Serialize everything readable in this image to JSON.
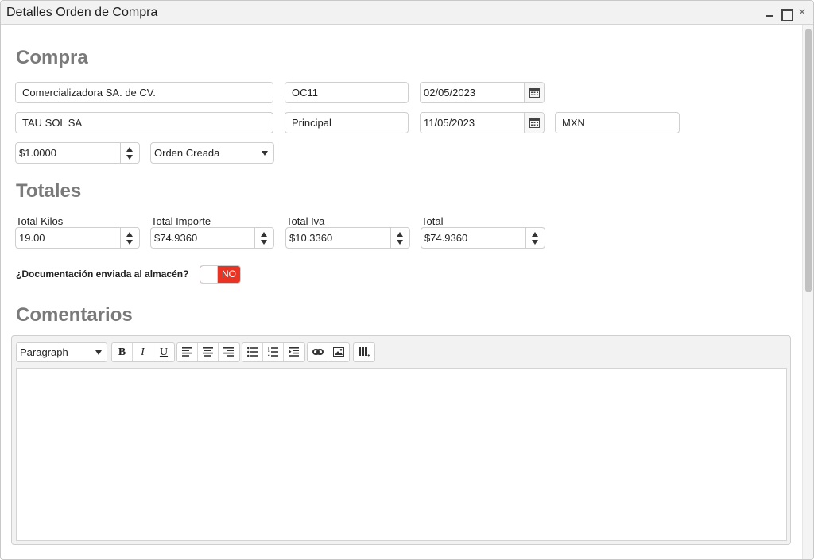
{
  "window": {
    "title": "Detalles Orden de Compra",
    "close_glyph": "×"
  },
  "compra": {
    "heading": "Compra",
    "proveedor_empresa": "Comercializadora SA. de CV.",
    "folio": "OC11",
    "fecha": "02/05/2023",
    "cliente": "TAU SOL SA",
    "almacen": "Principal",
    "fecha_entrega": "11/05/2023",
    "moneda": "MXN",
    "tipo_cambio": "$1.0000",
    "estado": "Orden Creada"
  },
  "totales": {
    "heading": "Totales",
    "total_kilos": {
      "label": "Total Kilos",
      "value": "19.00"
    },
    "total_importe": {
      "label": "Total Importe",
      "value": "$74.9360"
    },
    "total_iva": {
      "label": "Total Iva",
      "value": "$10.3360"
    },
    "total": {
      "label": "Total",
      "value": "$74.9360"
    }
  },
  "documentacion": {
    "label": "¿Documentación enviada al almacén?",
    "toggle_text": "NO",
    "toggle_color": "#ea3323"
  },
  "comentarios": {
    "heading": "Comentarios",
    "format_select": "Paragraph",
    "toolbar": {
      "bold": "B",
      "italic": "I",
      "underline": "U",
      "icons": [
        "align-left-icon",
        "align-center-icon",
        "align-right-icon",
        "bullet-list-icon",
        "numbered-list-icon",
        "indent-icon",
        "link-icon",
        "image-icon",
        "table-icon"
      ]
    },
    "body": ""
  }
}
